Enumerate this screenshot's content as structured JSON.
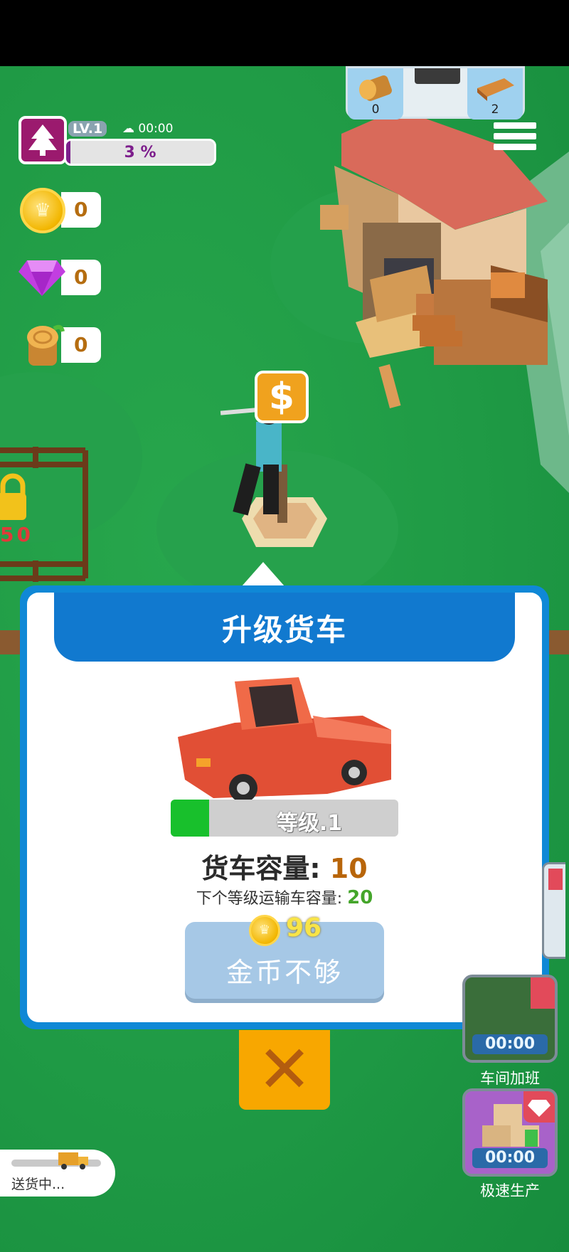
{
  "hud": {
    "level_label": "LV.1",
    "timer": "00:00",
    "xp_percent_text": "3 %",
    "xp_fraction": 0.03,
    "coins": "0",
    "gems": "0",
    "wood": "0"
  },
  "storage": {
    "log_count": "0",
    "plank_count": "2"
  },
  "tree_tile_label": "50",
  "dialog": {
    "title": "升级货车",
    "level_text": "等级.1",
    "level_fill_fraction": 0.17,
    "capacity_label": "货车容量:",
    "capacity_value": "10",
    "next_label": "下个等级运输车容量:",
    "next_value": "20",
    "price": "96",
    "button_label": "金币不够"
  },
  "side_buttons": [
    {
      "label": "车间加班",
      "timer": "00:00"
    },
    {
      "label": "极速生产",
      "timer": "00:00"
    }
  ],
  "delivery": {
    "status": "送货中..."
  },
  "colors": {
    "grass": "#1f9a45",
    "dialog_border": "#0f88d6",
    "header_blue": "#1179cf",
    "close_orange": "#f8a700",
    "level_green": "#18c02c",
    "capacity_orange": "#b8650a",
    "next_green": "#44a52a"
  }
}
